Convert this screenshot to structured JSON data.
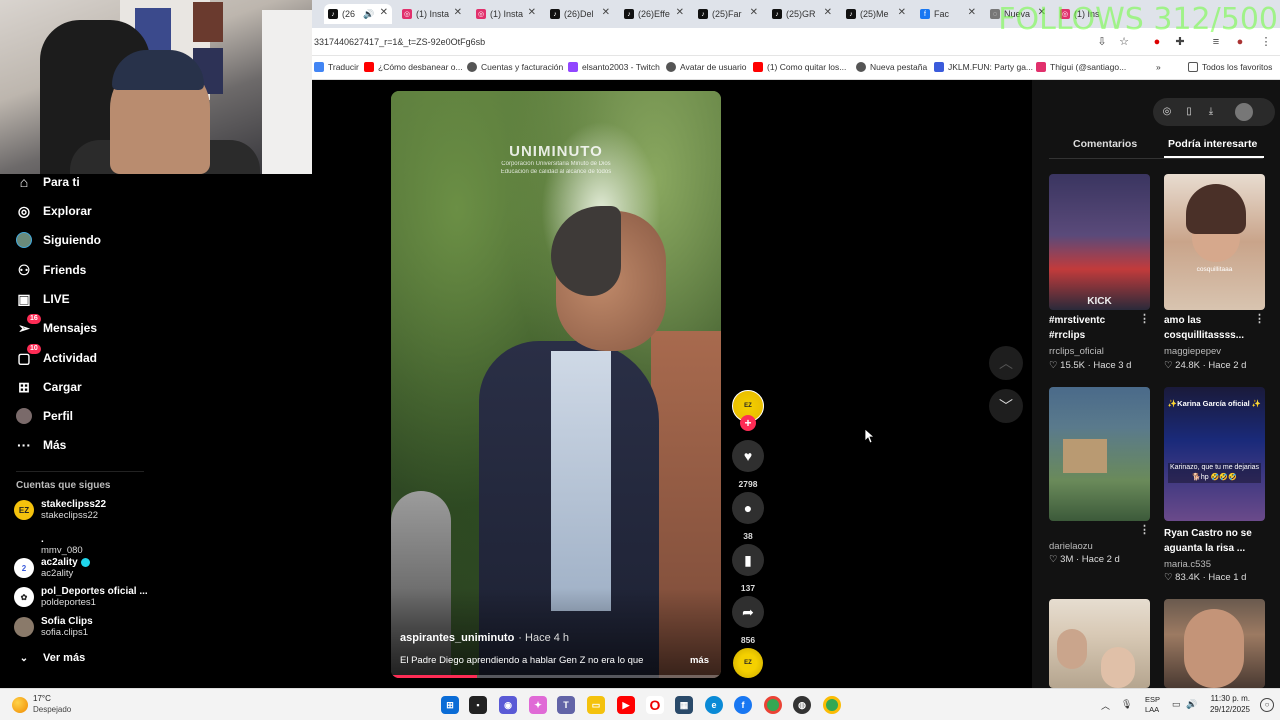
{
  "overlay": {
    "follows_text": "FOLLOWS 312/500"
  },
  "browser": {
    "tabs": [
      {
        "label": "(26",
        "favicon": "tiktok-icon"
      },
      {
        "label": "(1) Insta",
        "favicon": "instagram-icon"
      },
      {
        "label": "(1) Insta",
        "favicon": "instagram-icon"
      },
      {
        "label": "(26)Del",
        "favicon": "tiktok-icon"
      },
      {
        "label": "(26)Effe",
        "favicon": "tiktok-icon"
      },
      {
        "label": "(25)Far",
        "favicon": "tiktok-icon"
      },
      {
        "label": "(25)GR",
        "favicon": "tiktok-icon"
      },
      {
        "label": "(25)Me",
        "favicon": "tiktok-icon"
      },
      {
        "label": "Fac",
        "favicon": "facebook-icon"
      },
      {
        "label": "Nueva",
        "favicon": "globe-icon"
      },
      {
        "label": "(1) Ins",
        "favicon": "instagram-icon"
      }
    ],
    "url": "3317440627417_r=1&_t=ZS-92e0OtFg6sb",
    "bookmarks": [
      {
        "label": "Traducir",
        "color": "#4285f4"
      },
      {
        "label": "¿Cómo desbanear o...",
        "color": "#ff0000"
      },
      {
        "label": "Cuentas y facturación",
        "color": "#555555"
      },
      {
        "label": "elsanto2003 - Twitch",
        "color": "#9146ff"
      },
      {
        "label": "Avatar de usuario",
        "color": "#555555"
      },
      {
        "label": "(1) Como quitar los...",
        "color": "#ff0000"
      },
      {
        "label": "Nueva pestaña",
        "color": "#555555"
      },
      {
        "label": "JKLM.FUN: Party ga...",
        "color": "#3b5bdb"
      },
      {
        "label": "Thigui (@santiago...",
        "color": "#e1306c"
      }
    ],
    "all_favorites": "Todos los favoritos"
  },
  "nav": {
    "items": [
      {
        "label": "Para ti",
        "icon": "home-icon"
      },
      {
        "label": "Explorar",
        "icon": "compass-icon"
      },
      {
        "label": "Siguiendo",
        "icon": "following-avatar"
      },
      {
        "label": "Friends",
        "icon": "friends-icon"
      },
      {
        "label": "LIVE",
        "icon": "live-icon"
      },
      {
        "label": "Mensajes",
        "icon": "messages-icon",
        "badge": "16"
      },
      {
        "label": "Actividad",
        "icon": "activity-icon",
        "badge": "10"
      },
      {
        "label": "Cargar",
        "icon": "upload-icon"
      },
      {
        "label": "Perfil",
        "icon": "profile-avatar"
      },
      {
        "label": "Más",
        "icon": "more-icon"
      }
    ],
    "following_title": "Cuentas que sigues",
    "accounts": [
      {
        "name": "stakeclipss22",
        "handle": "stakeclipss22",
        "color": "#f4c20d",
        "verified": false
      },
      {
        "name": ".",
        "handle": "mmv_080",
        "color": "#000000",
        "verified": false
      },
      {
        "name": "ac2ality",
        "handle": "ac2ality",
        "color": "#3b5bdb",
        "verified": true
      },
      {
        "name": "pol_Deportes oficial ...",
        "handle": "poldeportes1",
        "color": "#ffffff",
        "verified": false
      },
      {
        "name": "Sofia Clips",
        "handle": "sofia.clips1",
        "color": "#8a7a6a",
        "verified": false
      }
    ],
    "see_more": "Ver más"
  },
  "video": {
    "logo": "UNIMINUTO",
    "logo_sub1": "Corporación Universitaria Minuto de Dios",
    "logo_sub2": "Educación de calidad al alcance de todos",
    "author": "aspirantes_uniminuto",
    "time": "· Hace 4 h",
    "caption": "El Padre Diego aprendiendo a hablar Gen Z no era lo que",
    "more": "más",
    "progress": 0.26,
    "likes": "2798",
    "comments": "38",
    "saves": "137",
    "shares": "856"
  },
  "panel": {
    "tabs": [
      "Comentarios",
      "Podría interesarte"
    ],
    "cards": [
      {
        "title1": "#mrstiventc",
        "title2": "#rrclips",
        "author": "rrclips_oficial",
        "stats": "♡ 15.5K · Hace 3 d",
        "thumb_text": "KICK",
        "colors": [
          "#3a3560",
          "#c23b3b"
        ]
      },
      {
        "title1": "amo las",
        "title2": "cosquillitassss...",
        "author": "maggiepepev",
        "stats": "♡ 24.8K · Hace 2 d",
        "thumb_text": "cosquillitaaa",
        "colors": [
          "#d8c4b0",
          "#8a6a55"
        ]
      },
      {
        "title1": "",
        "title2": "",
        "author": "darielaozu",
        "stats": "♡ 3M · Hace 2 d",
        "thumb_text": "",
        "colors": [
          "#5a7a8c",
          "#3c5a3a"
        ]
      },
      {
        "title1": "Ryan Castro no se",
        "title2": "aguanta la risa ...",
        "author": "maria.c535",
        "stats": "♡ 83.4K · Hace 1 d",
        "thumb_text": "Karinazo, que tu me dejarias 🐕hp 🤣🤣🤣",
        "thumb_top": "✨Karina García oficial ✨",
        "colors": [
          "#1a2a7a",
          "#6a4a8a"
        ]
      },
      {
        "title1": "",
        "title2": "",
        "author": "",
        "stats": "",
        "thumb_text": "",
        "colors": [
          "#e6ddd0",
          "#b5a58f"
        ]
      },
      {
        "title1": "",
        "title2": "",
        "author": "",
        "stats": "",
        "thumb_text": "",
        "colors": [
          "#9c7a62",
          "#4a3a32"
        ]
      }
    ]
  },
  "taskbar": {
    "temp": "17°C",
    "condition": "Despejado",
    "lang1": "ESP",
    "lang2": "LAA",
    "time": "11:30 p. m.",
    "date": "29/12/2025"
  }
}
